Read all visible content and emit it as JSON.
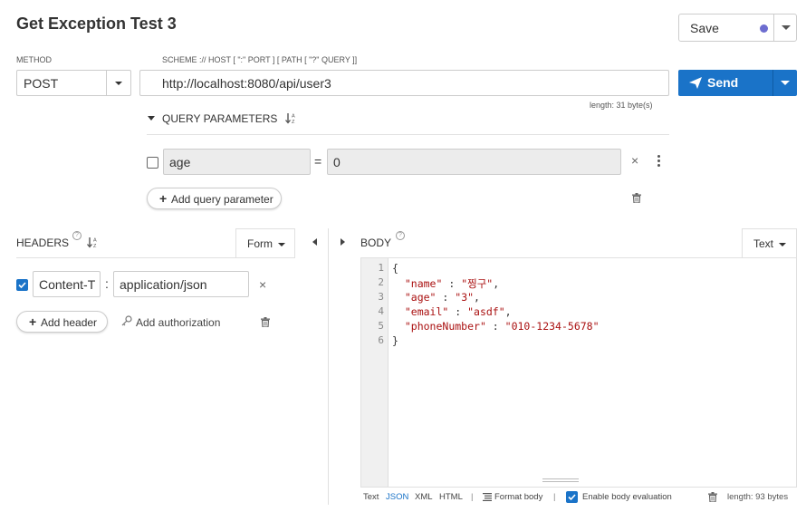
{
  "request": {
    "title": "Get Exception Test 3",
    "save_label": "Save",
    "method_label": "METHOD",
    "method_value": "POST",
    "url_label": "SCHEME :// HOST [ \":\" PORT ] [ PATH [ \"?\" QUERY ]]",
    "url_value": "http://localhost:8080/api/user3",
    "url_length": "length: 31 byte(s)",
    "send_label": "Send"
  },
  "query": {
    "title": "QUERY PARAMETERS",
    "params": [
      {
        "enabled": false,
        "key": "age",
        "equals": "=",
        "value": "0"
      }
    ],
    "add_label": "Add query parameter"
  },
  "headers": {
    "title": "HEADERS",
    "mode": "Form",
    "rows": [
      {
        "enabled": true,
        "key": "Content-T",
        "colon": ":",
        "value": "application/json"
      }
    ],
    "add_label": "Add header",
    "auth_label": "Add authorization"
  },
  "body": {
    "title": "BODY",
    "mode": "Text",
    "lines": [
      {
        "num": "1",
        "text": "{"
      },
      {
        "num": "2",
        "key": "\"name\"",
        "sep": " : ",
        "val": "\"찡구\"",
        "tail": ","
      },
      {
        "num": "3",
        "key": "\"age\"",
        "sep": " : ",
        "val": "\"3\"",
        "tail": ","
      },
      {
        "num": "4",
        "key": "\"email\"",
        "sep": " : ",
        "val": "\"asdf\"",
        "tail": ","
      },
      {
        "num": "5",
        "key": "\"phoneNumber\"",
        "sep": " : ",
        "val": "\"010-1234-5678\"",
        "tail": ""
      },
      {
        "num": "6",
        "text": "}"
      }
    ],
    "footer": {
      "text": "Text",
      "json": "JSON",
      "xml": "XML",
      "html": "HTML",
      "divider": "|",
      "format": "Format body",
      "eval": "Enable body evaluation",
      "length": "length: 93 bytes"
    }
  },
  "colors": {
    "accent": "#1a73c8",
    "dot": "#6d6dd0",
    "string": "#a11"
  }
}
